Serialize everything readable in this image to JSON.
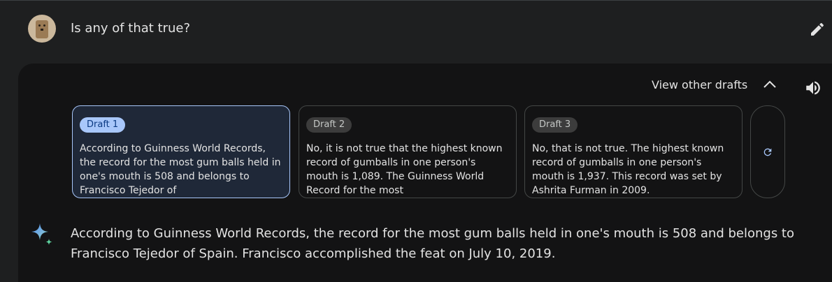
{
  "prompt": {
    "text": "Is any of that true?"
  },
  "drafts_header": {
    "label": "View other drafts"
  },
  "drafts": [
    {
      "badge": "Draft 1",
      "text": "According to Guinness World Records, the record for the most gum balls held in one's mouth is 508 and belongs to Francisco Tejedor of",
      "selected": true
    },
    {
      "badge": "Draft 2",
      "text": "No, it is not true that the highest known record of gumballs in one person's mouth is 1,089. The Guinness World Record for the most",
      "selected": false
    },
    {
      "badge": "Draft 3",
      "text": "No, that is not true. The highest known record of gumballs in one person's mouth is 1,937. This record was set by Ashrita Furman in 2009.",
      "selected": false
    }
  ],
  "response": {
    "text": "According to Guinness World Records, the record for the most gum balls held in one's mouth is 508 and belongs to Francisco Tejedor of Spain. Francisco accomplished the feat on July 10, 2019."
  },
  "icons": {
    "edit": "pencil-icon",
    "collapse": "chevron-up-icon",
    "speaker": "speaker-icon",
    "regenerate": "refresh-icon",
    "assistant": "sparkle-icon"
  },
  "colors": {
    "background": "#1e1f20",
    "panel": "#131314",
    "accent": "#a8c7fa",
    "selected_draft_bg": "#1f2838"
  }
}
